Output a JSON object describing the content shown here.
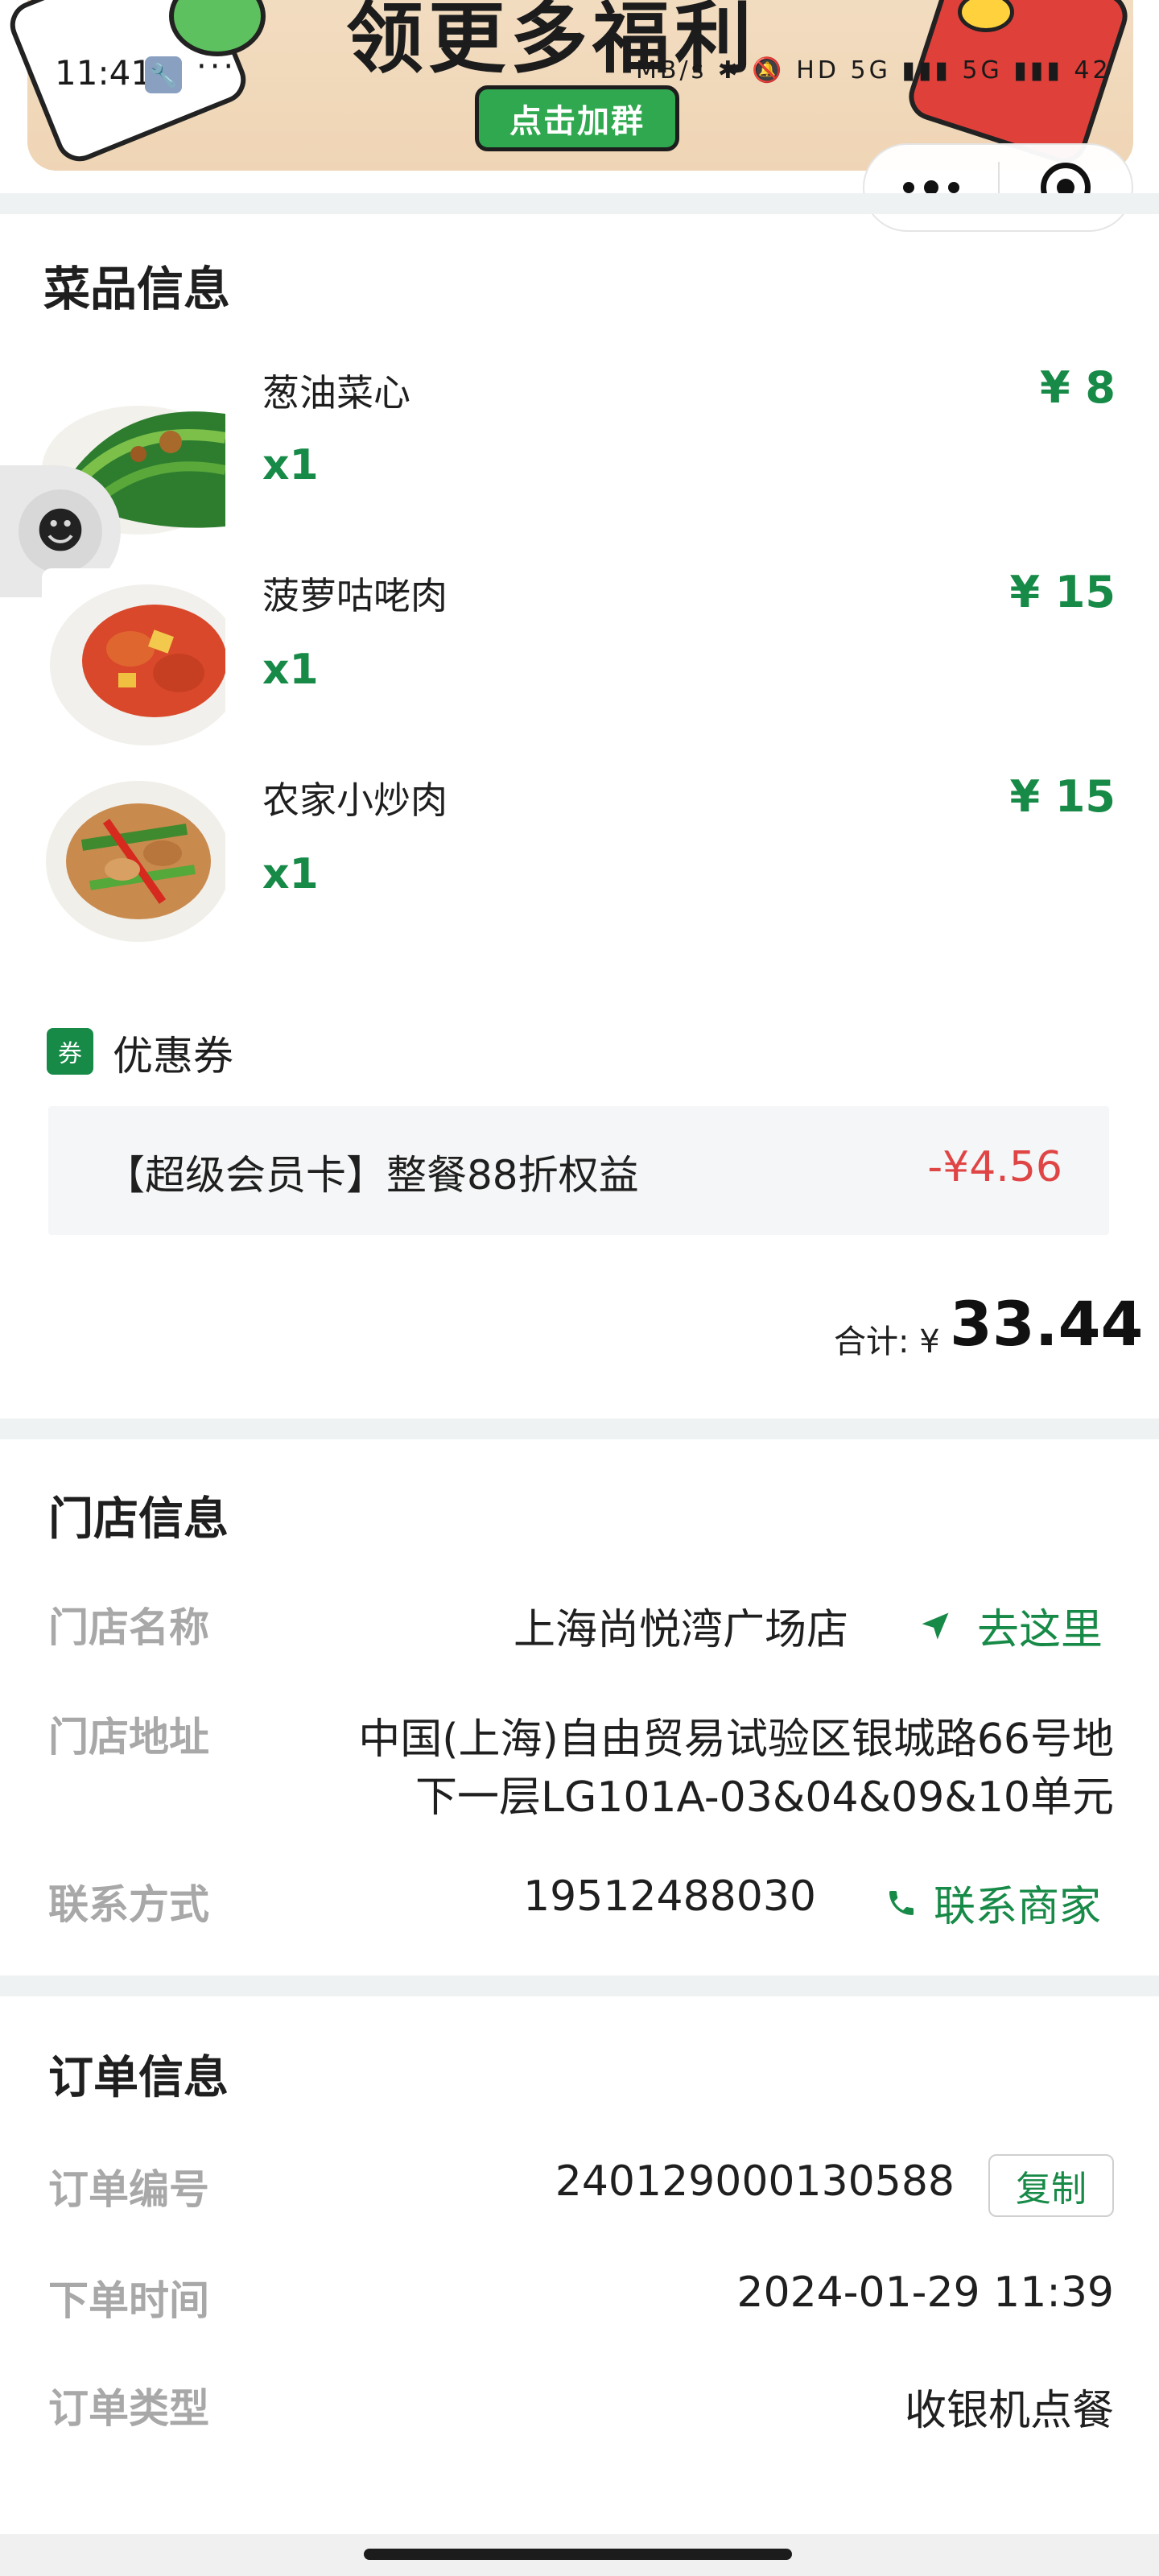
{
  "status_bar": {
    "time": "11:41",
    "indicators": "MB/s ✱ 🔕 HD 5G ▮▮▮ 5G ▮▮▮ 42"
  },
  "banner": {
    "headline": "领更多福利",
    "button_label": "点击加群"
  },
  "dishes": {
    "title": "菜品信息",
    "items": [
      {
        "name": "葱油菜心",
        "qty": "x1",
        "price": "¥ 8"
      },
      {
        "name": "菠萝咕咾肉",
        "qty": "x1",
        "price": "¥ 15"
      },
      {
        "name": "农家小炒肉",
        "qty": "x1",
        "price": "¥ 15"
      }
    ]
  },
  "coupon": {
    "tag": "券",
    "label": "优惠券",
    "name": "【超级会员卡】整餐88折权益",
    "amount": "-¥4.56"
  },
  "total": {
    "label": "合计: ¥",
    "value": "33.44"
  },
  "store": {
    "title": "门店信息",
    "name_label": "门店名称",
    "name_value": "上海尚悦湾广场店",
    "navigate_label": "去这里",
    "address_label": "门店地址",
    "address_line1": "中国(上海)自由贸易试验区银城路66号地",
    "address_line2": "下一层LG101A-03&04&09&10单元",
    "contact_label": "联系方式",
    "contact_value": "19512488030",
    "call_label": "联系商家"
  },
  "order": {
    "title": "订单信息",
    "number_label": "订单编号",
    "number_value": "240129000130588",
    "copy_label": "复制",
    "time_label": "下单时间",
    "time_value": "2024-01-29 11:39",
    "type_label": "订单类型",
    "type_value": "收银机点餐"
  },
  "colors": {
    "accent_green": "#178a47",
    "discount_red": "#e04545",
    "divider": "#eef2f3"
  },
  "icons": [
    "wrench-icon",
    "more-icon",
    "close-miniprogram-icon",
    "navigate-arrow-icon",
    "phone-icon"
  ]
}
